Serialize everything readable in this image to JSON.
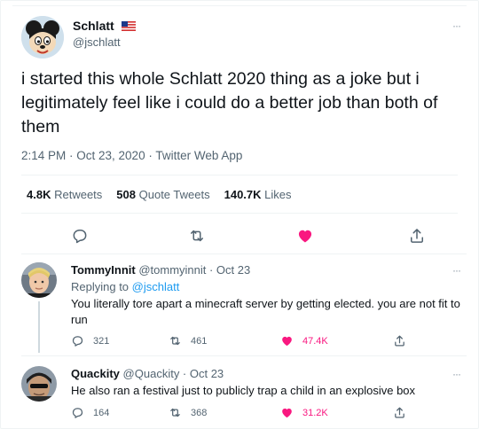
{
  "main_tweet": {
    "author_name": "Schlatt",
    "author_handle": "@jschlatt",
    "text": "i started this whole Schlatt 2020 thing as a joke but i legitimately feel like i could do a better job than both of them",
    "timestamp": "2:14 PM · Oct 23, 2020 · Twitter Web App",
    "stats": {
      "retweets_count": "4.8K",
      "retweets_label": "Retweets",
      "quotes_count": "508",
      "quotes_label": "Quote Tweets",
      "likes_count": "140.7K",
      "likes_label": "Likes"
    },
    "liked": true
  },
  "replies": [
    {
      "name": "TommyInnit",
      "handle": "@tommyinnit · Oct 23",
      "replying_prefix": "Replying to ",
      "replying_to": "@jschlatt",
      "text": "You literally tore apart a minecraft server by getting elected. you are not fit to run",
      "reply_count": "321",
      "retweet_count": "461",
      "like_count": "47.4K"
    },
    {
      "name": "Quackity",
      "handle": "@Quackity · Oct 23",
      "text": "He also ran a festival just to publicly trap a child in an explosive box",
      "reply_count": "164",
      "retweet_count": "368",
      "like_count": "31.2K"
    }
  ],
  "more_icon": "···",
  "colors": {
    "like": "#f91880",
    "link": "#1d9bf0",
    "muted": "#536471",
    "text": "#0f1419"
  },
  "icons": [
    "reply-icon",
    "retweet-icon",
    "heart-icon",
    "share-icon",
    "more-icon",
    "us-flag-icon"
  ]
}
